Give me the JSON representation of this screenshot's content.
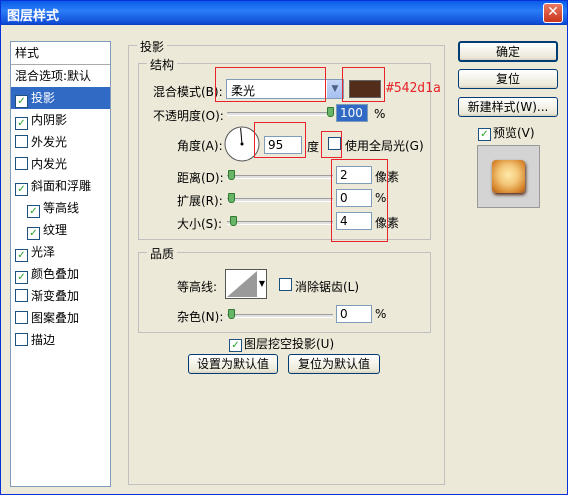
{
  "window": {
    "title": "图层样式"
  },
  "left_panel": {
    "header": "样式",
    "items": [
      {
        "label": "混合选项:默认",
        "checkbox": false,
        "checked": false,
        "selected": false,
        "indent": false
      },
      {
        "label": "投影",
        "checkbox": true,
        "checked": true,
        "selected": true,
        "indent": false
      },
      {
        "label": "内阴影",
        "checkbox": true,
        "checked": true,
        "selected": false,
        "indent": false
      },
      {
        "label": "外发光",
        "checkbox": true,
        "checked": false,
        "selected": false,
        "indent": false
      },
      {
        "label": "内发光",
        "checkbox": true,
        "checked": false,
        "selected": false,
        "indent": false
      },
      {
        "label": "斜面和浮雕",
        "checkbox": true,
        "checked": true,
        "selected": false,
        "indent": false
      },
      {
        "label": "等高线",
        "checkbox": true,
        "checked": true,
        "selected": false,
        "indent": true
      },
      {
        "label": "纹理",
        "checkbox": true,
        "checked": true,
        "selected": false,
        "indent": true
      },
      {
        "label": "光泽",
        "checkbox": true,
        "checked": true,
        "selected": false,
        "indent": false
      },
      {
        "label": "颜色叠加",
        "checkbox": true,
        "checked": true,
        "selected": false,
        "indent": false
      },
      {
        "label": "渐变叠加",
        "checkbox": true,
        "checked": false,
        "selected": false,
        "indent": false
      },
      {
        "label": "图案叠加",
        "checkbox": true,
        "checked": false,
        "selected": false,
        "indent": false
      },
      {
        "label": "描边",
        "checkbox": true,
        "checked": false,
        "selected": false,
        "indent": false
      }
    ]
  },
  "drop_shadow": {
    "group_label": "投影",
    "structure": {
      "group_label": "结构",
      "blend_mode_label": "混合模式(B):",
      "blend_mode_value": "柔光",
      "color_swatch": "#542d1a",
      "color_note": "#542d1a",
      "opacity_label": "不透明度(O):",
      "opacity_value": "100",
      "percent": "%",
      "angle_label": "角度(A):",
      "angle_value": "95",
      "degree_unit": "度",
      "global_light_label": "使用全局光(G)",
      "distance_label": "距离(D):",
      "distance_value": "2",
      "spread_label": "扩展(R):",
      "spread_value": "0",
      "size_label": "大小(S):",
      "size_value": "4",
      "pixel_unit": "像素"
    },
    "quality": {
      "group_label": "品质",
      "contour_label": "等高线:",
      "anti_alias_label": "消除锯齿(L)",
      "noise_label": "杂色(N):",
      "noise_value": "0",
      "percent": "%"
    },
    "knockout_label": "图层挖空投影(U)",
    "make_default_label": "设置为默认值",
    "reset_default_label": "复位为默认值"
  },
  "buttons": {
    "ok": "确定",
    "reset": "复位",
    "new_style": "新建样式(W)...",
    "preview_label": "预览(V)"
  }
}
